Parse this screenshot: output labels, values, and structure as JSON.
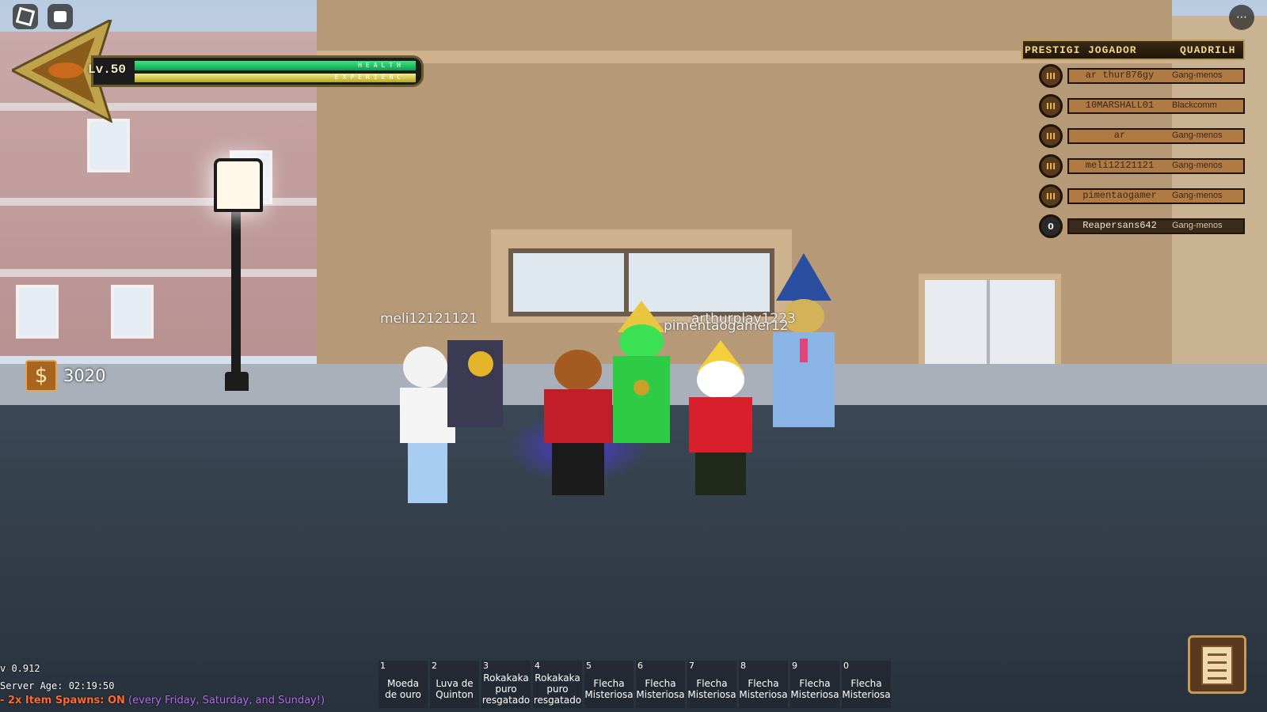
{
  "topbar": {
    "roblox_icon": "roblox-logo-icon",
    "chat_icon": "chat-icon",
    "menu_icon": "more-icon"
  },
  "player": {
    "level_label": "Lv.50",
    "health_label": "HEALTH",
    "experience_label": "EXPERIENC",
    "health_fraction": 1.0,
    "experience_fraction": 1.0,
    "money": "3020",
    "money_symbol": "$"
  },
  "leaderboard": {
    "columns": [
      "PRESTIGI",
      "JOGADOR",
      "QUADRILH"
    ],
    "rows": [
      {
        "badge": "III",
        "name": "ar thur876gy",
        "gang": "Gang-menos"
      },
      {
        "badge": "III",
        "name": "10MARSHALL01",
        "gang": "Blackcomm"
      },
      {
        "badge": "III",
        "name": "ar",
        "gang": "Gang-menos"
      },
      {
        "badge": "III",
        "name": "meli12121121",
        "gang": "Gang-menos"
      },
      {
        "badge": "III",
        "name": "pimentaogamer",
        "gang": "Gang-menos"
      },
      {
        "badge": "0",
        "name": "Reapersans642",
        "gang": "Gang-menos"
      }
    ]
  },
  "nametags": {
    "tag1": "meli12121121",
    "tag2": "arthurplay1223",
    "tag3": "pimentaogamer12"
  },
  "hotbar": [
    {
      "key": "1",
      "label": "Moeda de ouro"
    },
    {
      "key": "2",
      "label": "Luva de Quinton"
    },
    {
      "key": "3",
      "label": "Rokakaka puro resgatado"
    },
    {
      "key": "4",
      "label": "Rokakaka puro resgatado"
    },
    {
      "key": "5",
      "label": "Flecha Misteriosa"
    },
    {
      "key": "6",
      "label": "Flecha Misteriosa"
    },
    {
      "key": "7",
      "label": "Flecha Misteriosa"
    },
    {
      "key": "8",
      "label": "Flecha Misteriosa"
    },
    {
      "key": "9",
      "label": "Flecha Misteriosa"
    },
    {
      "key": "0",
      "label": "Flecha Misteriosa"
    }
  ],
  "footer": {
    "version": "v 0.912",
    "server_age": "Server Age: 02:19:50",
    "event_prefix": "- 2x Item Spawns: ON",
    "event_suffix": " (every Friday, Saturday, and Sunday!)"
  },
  "colors": {
    "health": "#1fbf62",
    "experience": "#d8cc3a",
    "leaderboard_bar": "#b07a45",
    "event_text": "#b56cf0",
    "event_prefix": "#ff6a2e"
  },
  "journal_icon": "journal-icon"
}
